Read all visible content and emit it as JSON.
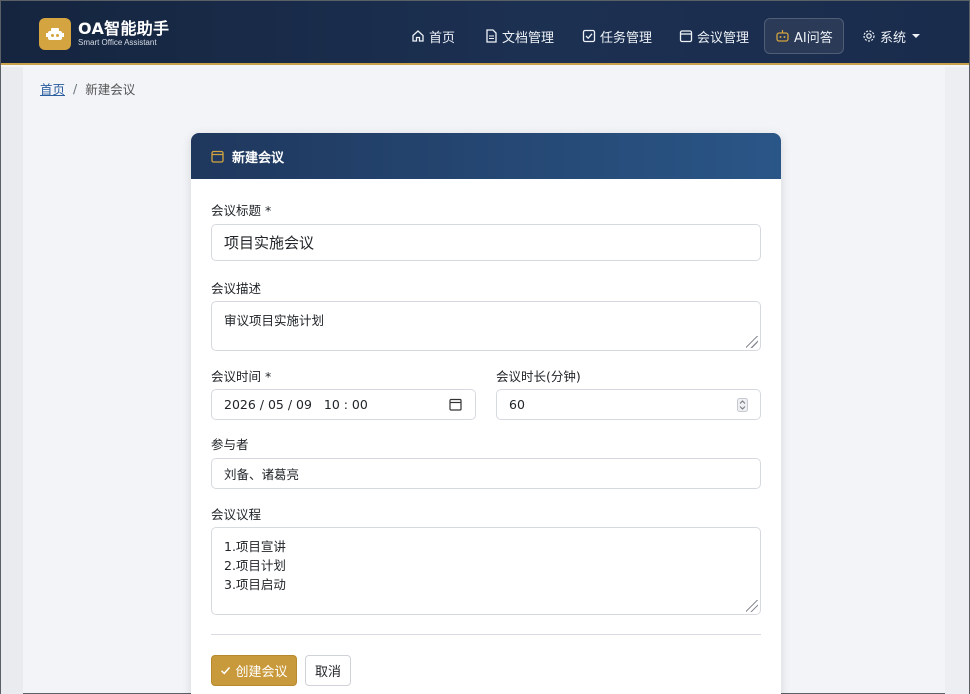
{
  "brand": {
    "title": "OA智能助手",
    "subtitle": "Smart Office Assistant"
  },
  "nav": {
    "items": [
      {
        "label": "首页",
        "icon": "home-icon"
      },
      {
        "label": "文档管理",
        "icon": "document-icon"
      },
      {
        "label": "任务管理",
        "icon": "checkbox-icon"
      },
      {
        "label": "会议管理",
        "icon": "calendar-icon"
      },
      {
        "label": "AI问答",
        "icon": "robot-icon"
      },
      {
        "label": "系统",
        "icon": "gear-icon"
      }
    ]
  },
  "breadcrumb": {
    "home": "首页",
    "separator": "/",
    "current": "新建会议"
  },
  "card": {
    "title": "新建会议"
  },
  "form": {
    "title_label": "会议标题 *",
    "title_value": "项目实施会议",
    "desc_label": "会议描述",
    "desc_value": "审议项目实施计划",
    "time_label": "会议时间 *",
    "time_value": "2026 / 05 / 09   10 : 00",
    "duration_label": "会议时长(分钟)",
    "duration_value": "60",
    "participants_label": "参与者",
    "participants_value": "刘备、诸葛亮",
    "agenda_label": "会议议程",
    "agenda_lines": [
      "1.项目宣讲",
      "2.项目计划",
      "3.项目启动"
    ]
  },
  "buttons": {
    "submit": "创建会议",
    "cancel": "取消"
  },
  "colors": {
    "navbar": "#1c3052",
    "accent": "#c99a3b",
    "card_header": "#2a5687"
  }
}
